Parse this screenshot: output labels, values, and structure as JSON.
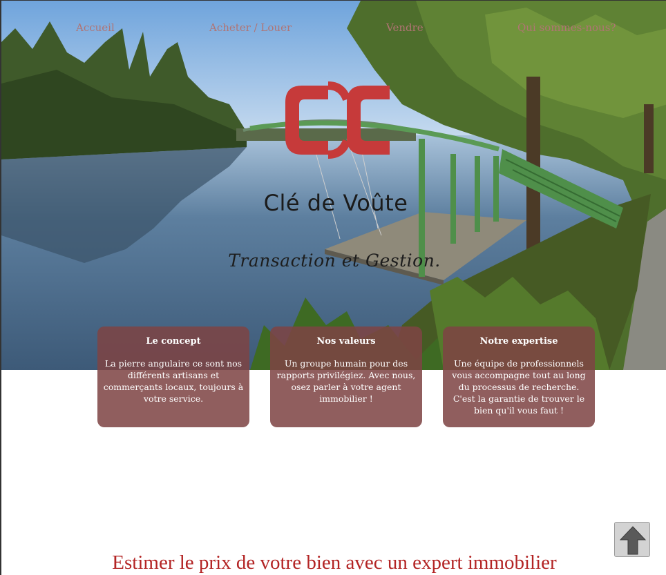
{
  "nav": {
    "items": [
      {
        "label": "Accueil"
      },
      {
        "label": "Acheter / Louer"
      },
      {
        "label": "Vendre"
      },
      {
        "label": "Qui sommes-nous?"
      }
    ]
  },
  "hero": {
    "brand_name": "Clé de Voûte",
    "tagline": "Transaction et Gestion.",
    "logo_icon": "double-c-logo-icon",
    "background": "river-landscape-photo"
  },
  "cards": [
    {
      "title": "Le concept",
      "text": "La pierre angulaire ce sont nos différents artisans et commerçants locaux, toujours à votre service."
    },
    {
      "title": "Nos valeurs",
      "text": "Un groupe humain pour des rapports privilégiez. Avec nous, osez parler à votre agent immobilier !"
    },
    {
      "title": "Notre expertise",
      "text": "Une équipe de professionnels vous accompagne tout au long du processus de recherche. C'est la garantie de trouver le bien qu'il vous faut !"
    }
  ],
  "estimate": {
    "title": "Estimer le prix de votre bien avec un expert immobilier"
  },
  "scroll_top": {
    "icon": "arrow-up-icon"
  },
  "colors": {
    "brand_red": "#c63a3a",
    "nav_text": "#b07474",
    "card_bg": "#7e4444",
    "heading_red": "#b32424"
  }
}
